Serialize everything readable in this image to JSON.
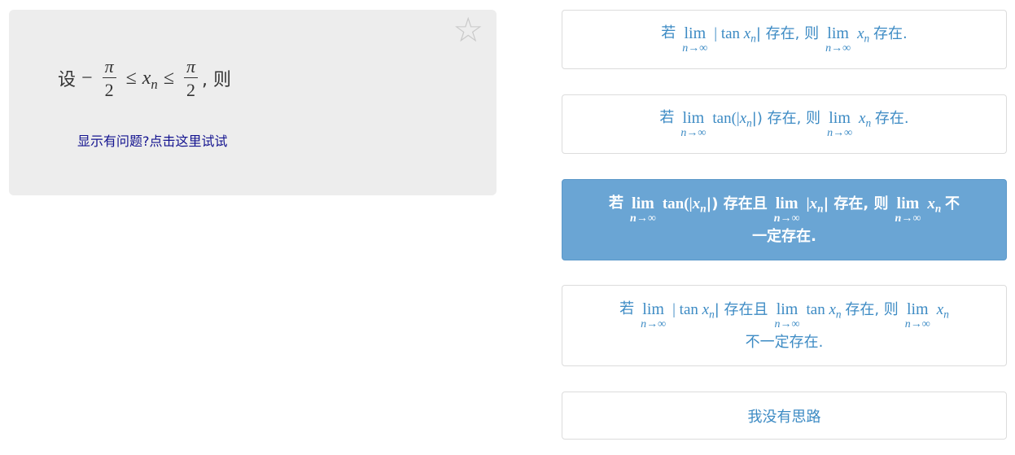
{
  "question": {
    "stem_prefix": "设",
    "minus": "−",
    "pi": "π",
    "two": "2",
    "leq": "≤",
    "x": "x",
    "n": "n",
    "suffix": ", 则",
    "help_link": "显示有问题?点击这里试试",
    "favorite_icon": "star-outline-icon"
  },
  "options": [
    {
      "ruo": "若",
      "lim": "lim",
      "sub": "n→∞",
      "expr1": "| tan",
      "expr1_end": "| 存在, 则",
      "end": "存在."
    },
    {
      "ruo": "若",
      "lim": "lim",
      "sub": "n→∞",
      "expr1": "tan(|",
      "expr1_end": "|) 存在, 则",
      "end": "存在."
    },
    {
      "ruo": "若",
      "lim": "lim",
      "sub": "n→∞",
      "expr1": "tan(|",
      "expr1_end": "|) 存在且",
      "expr2": "|",
      "expr2_end": "| 存在, 则",
      "end_a": "不",
      "end_b": "一定存在."
    },
    {
      "ruo": "若",
      "lim": "lim",
      "sub": "n→∞",
      "expr1": "| tan",
      "expr1_end": "| 存在且",
      "expr2": "tan",
      "expr2_end": "存在, 则",
      "end_b": "不一定存在."
    }
  ],
  "no_idea": "我没有思路",
  "colors": {
    "accent": "#3d8bc4",
    "selected_bg": "#6aa5d4",
    "card_bg": "#ededed",
    "link": "#13138f"
  }
}
